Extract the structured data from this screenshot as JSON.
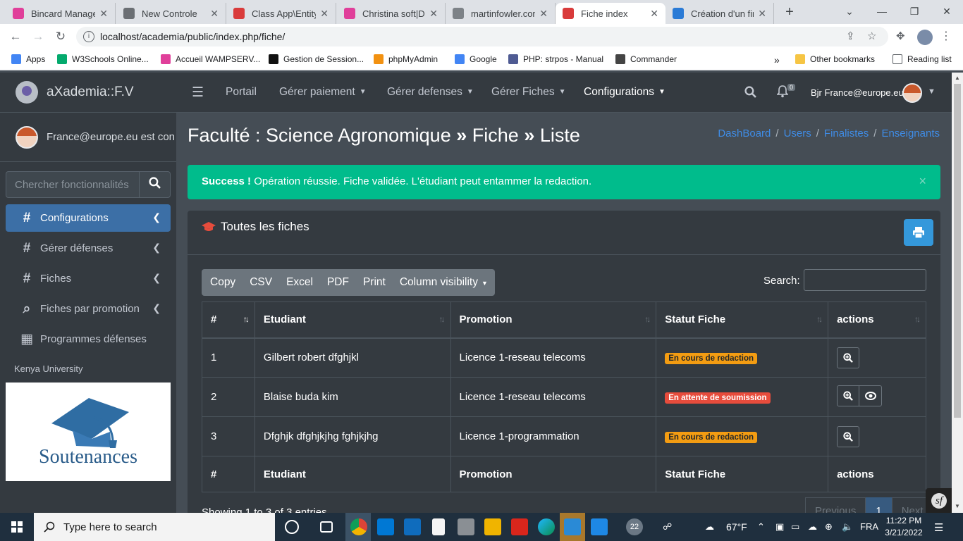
{
  "browser": {
    "tabs": [
      {
        "title": "Bincard Manager",
        "color": "#e03f9a"
      },
      {
        "title": "New Controle",
        "color": "#6b6f74"
      },
      {
        "title": "Class App\\Entity\\",
        "color": "#d93b3b"
      },
      {
        "title": "Christina soft|Da",
        "color": "#e03f9a"
      },
      {
        "title": "martinfowler.com",
        "color": "#7d8287"
      },
      {
        "title": "Fiche index",
        "color": "#d93b3b"
      },
      {
        "title": "Création d'un fin",
        "color": "#2b7bd6"
      }
    ],
    "active_tab_index": 5,
    "url": "localhost/academia/public/index.php/fiche/",
    "bookmarks": [
      {
        "label": "Apps",
        "color": "#4285f4"
      },
      {
        "label": "W3Schools Online...",
        "color": "#04aa6d"
      },
      {
        "label": "Accueil WAMPSERV...",
        "color": "#e03f9a"
      },
      {
        "label": "Gestion de Session...",
        "color": "#111111"
      },
      {
        "label": "phpMyAdmin",
        "color": "#f29111"
      },
      {
        "label": "Google",
        "color": "#4285f4"
      },
      {
        "label": "PHP: strpos - Manual",
        "color": "#4f5b93"
      },
      {
        "label": "Commander",
        "color": "#444444"
      }
    ],
    "other_bookmarks": "Other bookmarks",
    "reading_list": "Reading list",
    "more_glyph": "»"
  },
  "sidebar": {
    "brand": "aXademia::F.V",
    "user": "France@europe.eu est con",
    "search_placeholder": "Chercher fonctionnalités",
    "items": [
      {
        "label": "Configurations",
        "icon": "hash-icon",
        "active": true
      },
      {
        "label": "Gérer défenses",
        "icon": "hash-icon",
        "active": false
      },
      {
        "label": "Fiches",
        "icon": "hash-icon",
        "active": false
      },
      {
        "label": "Fiches par promotion",
        "icon": "search-icon",
        "active": false
      },
      {
        "label": "Programmes défenses",
        "icon": "calendar-icon",
        "active": false
      }
    ],
    "university": "Kenya University",
    "image_text": "Soutenances"
  },
  "topnav": {
    "portail": "Portail",
    "gerer_paiement": "Gérer paiement",
    "gerer_defenses": "Gérer defenses",
    "gerer_fiches": "Gérer Fiches",
    "configurations": "Configurations",
    "notif_count": "0",
    "greeting": "Bjr France@europe.eu"
  },
  "page": {
    "title_part1": "Faculté : Science Agronomique",
    "title_part2": "Fiche",
    "title_part3": "Liste",
    "breadcrumbs": [
      "DashBoard",
      "Users",
      "Finalistes",
      "Enseignants"
    ],
    "alert_strong": "Success !",
    "alert_text": " Opération réussie. Fiche validée. L'étudiant peut entammer la redaction.",
    "alert_close": "×"
  },
  "card": {
    "title": "Toutes les fiches",
    "export_buttons": [
      "Copy",
      "CSV",
      "Excel",
      "PDF",
      "Print",
      "Column visibility"
    ],
    "search_label": "Search:",
    "columns": [
      "#",
      "Etudiant",
      "Promotion",
      "Statut Fiche",
      "actions"
    ],
    "rows": [
      {
        "num": "1",
        "etudiant": "Gilbert robert dfghjkl",
        "promotion": "Licence 1-reseau telecoms",
        "statut": "En cours de redaction",
        "statut_color": "#f39c12",
        "has_eye": false
      },
      {
        "num": "2",
        "etudiant": "Blaise buda kim",
        "promotion": "Licence 1-reseau telecoms",
        "statut": "En attente de soumission",
        "statut_color": "#e74c3c",
        "has_eye": true
      },
      {
        "num": "3",
        "etudiant": "Dfghjk dfghjkjhg fghjkjhg",
        "promotion": "Licence 1-programmation",
        "statut": "En cours de redaction",
        "statut_color": "#f39c12",
        "has_eye": false
      }
    ],
    "showing": "Showing 1 to 3 of 3 entries",
    "pager": [
      "Previous",
      "1",
      "Next"
    ]
  },
  "taskbar": {
    "search_placeholder": "Type here to search",
    "notif_badge": "22",
    "weather": "67°F",
    "lang": "FRA",
    "time": "11:22 PM",
    "date": "3/21/2022"
  }
}
